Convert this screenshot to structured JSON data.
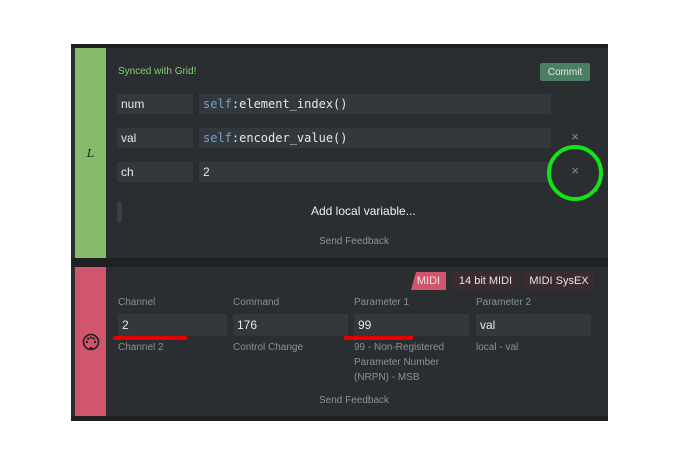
{
  "local_block": {
    "strip_label": "L",
    "status": "Synced with Grid!",
    "commit_label": "Commit",
    "variables": [
      {
        "name": "num",
        "kw": "self",
        "expr": ":element_index()"
      },
      {
        "name": "val",
        "kw": "self",
        "expr": ":encoder_value()"
      },
      {
        "name": "ch",
        "value": "2"
      }
    ],
    "remove_icon": "×",
    "add_label": "Add local variable...",
    "feedback": "Send Feedback"
  },
  "midi_block": {
    "strip_icon": "midi-connector-icon",
    "tabs": [
      "MIDI",
      "14 bit MIDI",
      "MIDI SysEX"
    ],
    "fields": [
      {
        "label": "Channel",
        "value": "2",
        "desc": "Channel 2"
      },
      {
        "label": "Command",
        "value": "176",
        "desc": "Control Change"
      },
      {
        "label": "Parameter 1",
        "value": "99",
        "desc": [
          "99 - Non-Registered",
          "Parameter Number",
          "(NRPN) - MSB"
        ]
      },
      {
        "label": "Parameter 2",
        "value": "val",
        "desc": "local - val"
      }
    ],
    "feedback": "Send Feedback"
  },
  "colors": {
    "local_strip": "#85bb6a",
    "midi_strip": "#d0556d",
    "highlight_circle": "#13e31a",
    "underline": "#e60000"
  }
}
